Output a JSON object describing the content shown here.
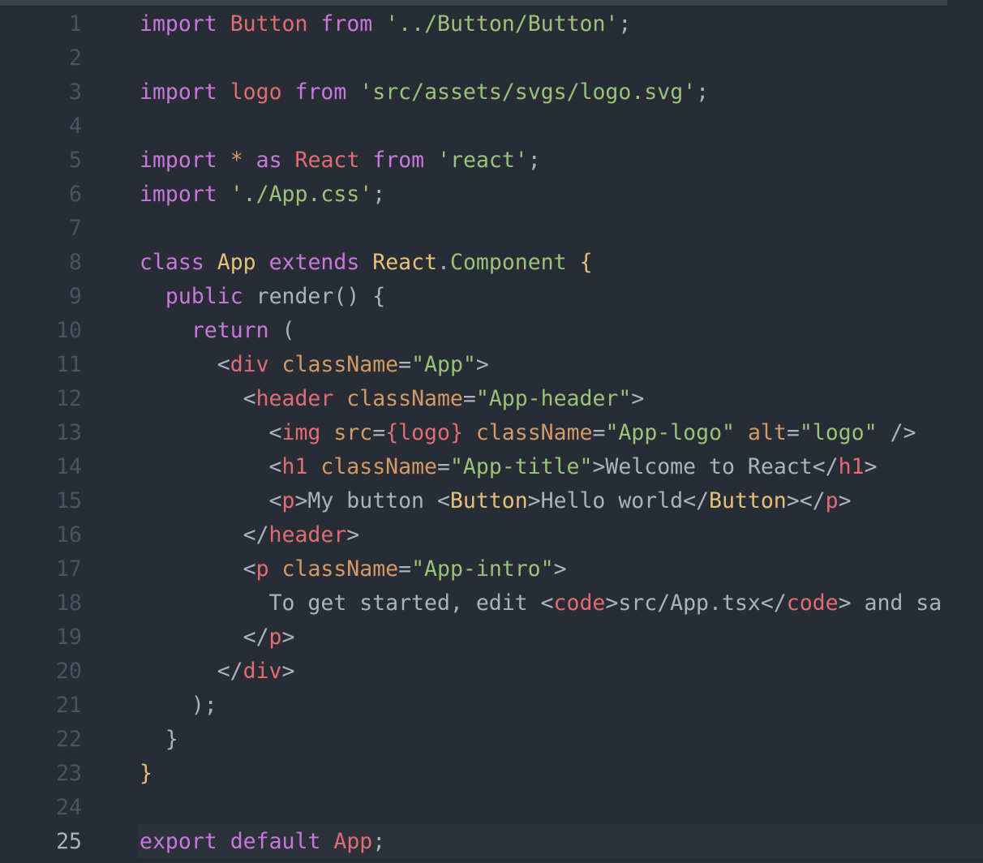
{
  "editor": {
    "current_line": 25,
    "theme_colors": {
      "background": "#282c34",
      "keyword": "#c678dd",
      "identifier": "#e06c75",
      "string": "#98c379",
      "class": "#e5c07b",
      "attribute": "#d19a66",
      "plain": "#abb2bf",
      "gutter": "#4b5263"
    },
    "lines": [
      [
        {
          "t": "kw",
          "v": "import"
        },
        {
          "t": "pl",
          "v": " "
        },
        {
          "t": "id",
          "v": "Button"
        },
        {
          "t": "pl",
          "v": " "
        },
        {
          "t": "kw",
          "v": "from"
        },
        {
          "t": "pl",
          "v": " "
        },
        {
          "t": "str",
          "v": "'../Button/Button'"
        },
        {
          "t": "pl",
          "v": ";"
        }
      ],
      [],
      [
        {
          "t": "kw",
          "v": "import"
        },
        {
          "t": "pl",
          "v": " "
        },
        {
          "t": "id",
          "v": "logo"
        },
        {
          "t": "pl",
          "v": " "
        },
        {
          "t": "kw",
          "v": "from"
        },
        {
          "t": "pl",
          "v": " "
        },
        {
          "t": "str",
          "v": "'src/assets/svgs/logo.svg'"
        },
        {
          "t": "pl",
          "v": ";"
        }
      ],
      [],
      [
        {
          "t": "kw",
          "v": "import"
        },
        {
          "t": "pl",
          "v": " "
        },
        {
          "t": "num",
          "v": "*"
        },
        {
          "t": "pl",
          "v": " "
        },
        {
          "t": "kw",
          "v": "as"
        },
        {
          "t": "pl",
          "v": " "
        },
        {
          "t": "id",
          "v": "React"
        },
        {
          "t": "pl",
          "v": " "
        },
        {
          "t": "kw",
          "v": "from"
        },
        {
          "t": "pl",
          "v": " "
        },
        {
          "t": "str",
          "v": "'react'"
        },
        {
          "t": "pl",
          "v": ";"
        }
      ],
      [
        {
          "t": "kw",
          "v": "import"
        },
        {
          "t": "pl",
          "v": " "
        },
        {
          "t": "str",
          "v": "'./App.css'"
        },
        {
          "t": "pl",
          "v": ";"
        }
      ],
      [],
      [
        {
          "t": "kw",
          "v": "class"
        },
        {
          "t": "pl",
          "v": " "
        },
        {
          "t": "cls",
          "v": "App"
        },
        {
          "t": "pl",
          "v": " "
        },
        {
          "t": "kw",
          "v": "extends"
        },
        {
          "t": "pl",
          "v": " "
        },
        {
          "t": "cls",
          "v": "React"
        },
        {
          "t": "pl",
          "v": "."
        },
        {
          "t": "str",
          "v": "Component"
        },
        {
          "t": "pl",
          "v": " "
        },
        {
          "t": "cls",
          "v": "{"
        }
      ],
      [
        {
          "t": "pl",
          "v": "  "
        },
        {
          "t": "kw",
          "v": "public"
        },
        {
          "t": "pl",
          "v": " render() {"
        }
      ],
      [
        {
          "t": "pl",
          "v": "    "
        },
        {
          "t": "kw",
          "v": "return"
        },
        {
          "t": "pl",
          "v": " ("
        }
      ],
      [
        {
          "t": "pl",
          "v": "      <"
        },
        {
          "t": "tag",
          "v": "div"
        },
        {
          "t": "pl",
          "v": " "
        },
        {
          "t": "attr",
          "v": "className"
        },
        {
          "t": "pl",
          "v": "="
        },
        {
          "t": "str",
          "v": "\"App\""
        },
        {
          "t": "pl",
          "v": ">"
        }
      ],
      [
        {
          "t": "pl",
          "v": "        <"
        },
        {
          "t": "tag",
          "v": "header"
        },
        {
          "t": "pl",
          "v": " "
        },
        {
          "t": "attr",
          "v": "className"
        },
        {
          "t": "pl",
          "v": "="
        },
        {
          "t": "str",
          "v": "\"App-header\""
        },
        {
          "t": "pl",
          "v": ">"
        }
      ],
      [
        {
          "t": "pl",
          "v": "          <"
        },
        {
          "t": "tag",
          "v": "img"
        },
        {
          "t": "pl",
          "v": " "
        },
        {
          "t": "attr",
          "v": "src"
        },
        {
          "t": "pl",
          "v": "="
        },
        {
          "t": "id",
          "v": "{logo}"
        },
        {
          "t": "pl",
          "v": " "
        },
        {
          "t": "attr",
          "v": "className"
        },
        {
          "t": "pl",
          "v": "="
        },
        {
          "t": "str",
          "v": "\"App-logo\""
        },
        {
          "t": "pl",
          "v": " "
        },
        {
          "t": "attr",
          "v": "alt"
        },
        {
          "t": "pl",
          "v": "="
        },
        {
          "t": "str",
          "v": "\"logo\""
        },
        {
          "t": "pl",
          "v": " />"
        }
      ],
      [
        {
          "t": "pl",
          "v": "          <"
        },
        {
          "t": "tag",
          "v": "h1"
        },
        {
          "t": "pl",
          "v": " "
        },
        {
          "t": "attr",
          "v": "className"
        },
        {
          "t": "pl",
          "v": "="
        },
        {
          "t": "str",
          "v": "\"App-title\""
        },
        {
          "t": "pl",
          "v": ">Welcome to React</"
        },
        {
          "t": "tag",
          "v": "h1"
        },
        {
          "t": "pl",
          "v": ">"
        }
      ],
      [
        {
          "t": "pl",
          "v": "          <"
        },
        {
          "t": "tag",
          "v": "p"
        },
        {
          "t": "pl",
          "v": ">My button <"
        },
        {
          "t": "cls",
          "v": "Button"
        },
        {
          "t": "pl",
          "v": ">Hello world</"
        },
        {
          "t": "cls",
          "v": "Button"
        },
        {
          "t": "pl",
          "v": "></"
        },
        {
          "t": "tag",
          "v": "p"
        },
        {
          "t": "pl",
          "v": ">"
        }
      ],
      [
        {
          "t": "pl",
          "v": "        </"
        },
        {
          "t": "tag",
          "v": "header"
        },
        {
          "t": "pl",
          "v": ">"
        }
      ],
      [
        {
          "t": "pl",
          "v": "        <"
        },
        {
          "t": "tag",
          "v": "p"
        },
        {
          "t": "pl",
          "v": " "
        },
        {
          "t": "attr",
          "v": "className"
        },
        {
          "t": "pl",
          "v": "="
        },
        {
          "t": "str",
          "v": "\"App-intro\""
        },
        {
          "t": "pl",
          "v": ">"
        }
      ],
      [
        {
          "t": "pl",
          "v": "          To get started, edit <"
        },
        {
          "t": "tag",
          "v": "code"
        },
        {
          "t": "pl",
          "v": ">src/App.tsx</"
        },
        {
          "t": "tag",
          "v": "code"
        },
        {
          "t": "pl",
          "v": "> and sa"
        }
      ],
      [
        {
          "t": "pl",
          "v": "        </"
        },
        {
          "t": "tag",
          "v": "p"
        },
        {
          "t": "pl",
          "v": ">"
        }
      ],
      [
        {
          "t": "pl",
          "v": "      </"
        },
        {
          "t": "tag",
          "v": "div"
        },
        {
          "t": "pl",
          "v": ">"
        }
      ],
      [
        {
          "t": "pl",
          "v": "    );"
        }
      ],
      [
        {
          "t": "pl",
          "v": "  }"
        }
      ],
      [
        {
          "t": "cls",
          "v": "}"
        }
      ],
      [],
      [
        {
          "t": "kw",
          "v": "export"
        },
        {
          "t": "pl",
          "v": " "
        },
        {
          "t": "kw",
          "v": "default"
        },
        {
          "t": "pl",
          "v": " "
        },
        {
          "t": "id",
          "v": "App"
        },
        {
          "t": "pl",
          "v": ";"
        }
      ]
    ]
  }
}
